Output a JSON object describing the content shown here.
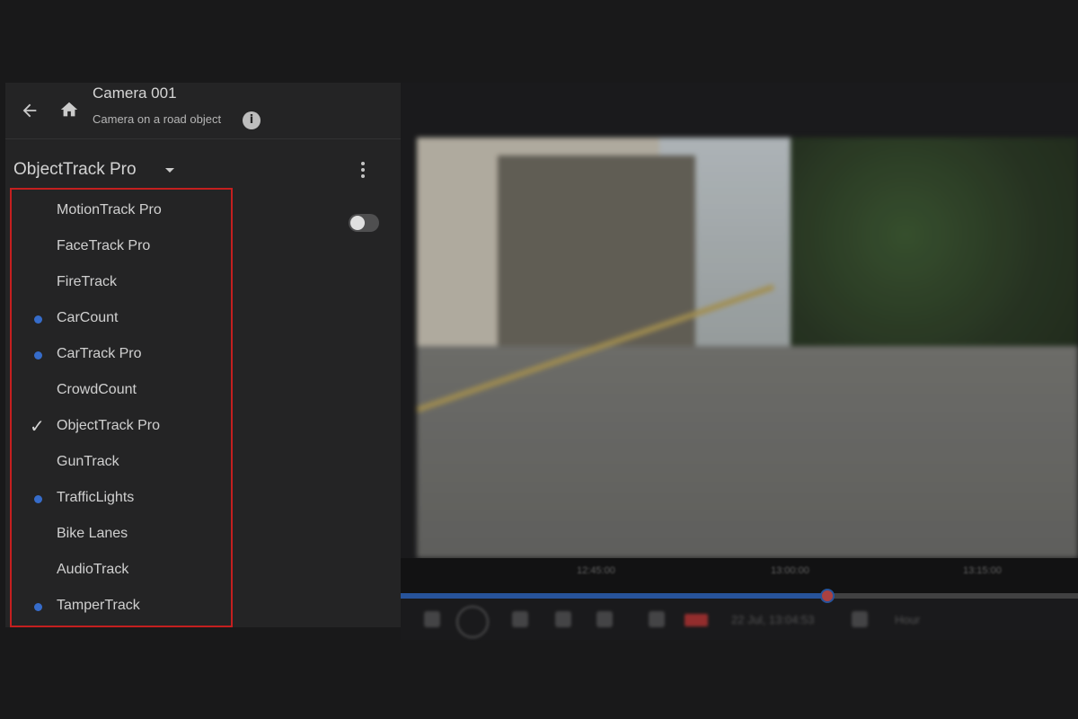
{
  "header": {
    "title": "Camera 001",
    "subtitle": "Camera on a road object",
    "back_icon": "arrow-left-icon",
    "home_icon": "home-icon",
    "info_icon": "info-icon"
  },
  "tracker": {
    "selected": "ObjectTrack Pro",
    "toggle_on": false
  },
  "menu": {
    "items": [
      {
        "label": "MotionTrack Pro",
        "marker": "none"
      },
      {
        "label": "FaceTrack Pro",
        "marker": "none"
      },
      {
        "label": "FireTrack",
        "marker": "none"
      },
      {
        "label": "CarCount",
        "marker": "dot"
      },
      {
        "label": "CarTrack Pro",
        "marker": "dot"
      },
      {
        "label": "CrowdCount",
        "marker": "none"
      },
      {
        "label": "ObjectTrack Pro",
        "marker": "check"
      },
      {
        "label": "GunTrack",
        "marker": "none"
      },
      {
        "label": "TrafficLights",
        "marker": "dot"
      },
      {
        "label": "Bike Lanes",
        "marker": "none"
      },
      {
        "label": "AudioTrack",
        "marker": "none"
      },
      {
        "label": "TamperTrack",
        "marker": "dot"
      }
    ]
  },
  "player": {
    "ticks": [
      "12:45:00",
      "13:00:00",
      "13:15:00"
    ],
    "progress": 0.63,
    "timestamp": "22 Jul, 13:04:53",
    "zoom": "Hour"
  },
  "colors": {
    "accent_dot": "#3e7be6",
    "highlight_border": "#e02424",
    "progress": "#2d5fb0"
  }
}
